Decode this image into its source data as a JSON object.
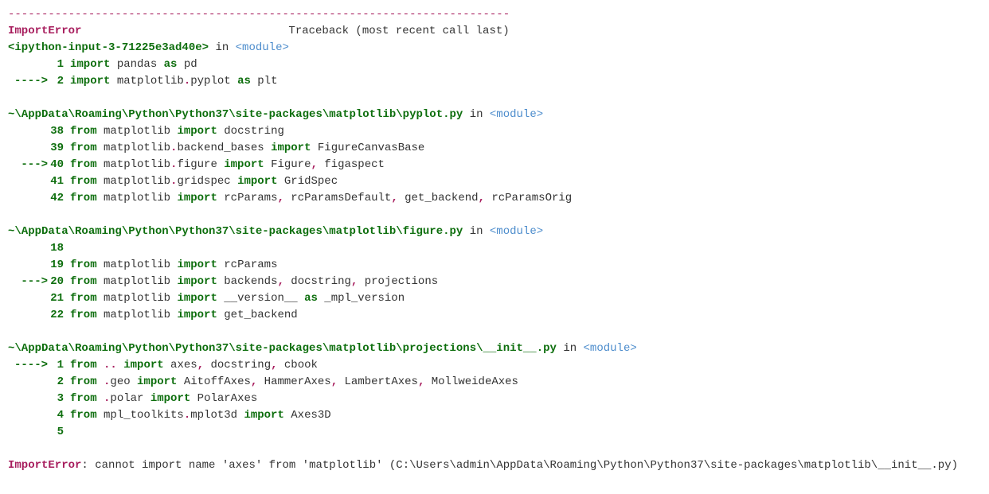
{
  "dashes": "---------------------------------------------------------------------------",
  "error_name": "ImportError",
  "traceback_label": "Traceback (most recent call last)",
  "frames": [
    {
      "path": "<ipython-input-3-71225e3ad40e>",
      "in": "in",
      "module": "<module>",
      "lines": [
        {
          "arrow": "",
          "no": "1",
          "tokens": [
            {
              "t": "import",
              "c": "kw"
            },
            {
              "t": " pandas ",
              "c": "name"
            },
            {
              "t": "as",
              "c": "kw"
            },
            {
              "t": " pd",
              "c": "name"
            }
          ]
        },
        {
          "arrow": "---->",
          "no": "2",
          "tokens": [
            {
              "t": "import",
              "c": "kw"
            },
            {
              "t": " matplotlib",
              "c": "name"
            },
            {
              "t": ".",
              "c": "op"
            },
            {
              "t": "pyplot ",
              "c": "name"
            },
            {
              "t": "as",
              "c": "kw"
            },
            {
              "t": " plt",
              "c": "name"
            }
          ]
        }
      ]
    },
    {
      "path": "~\\AppData\\Roaming\\Python\\Python37\\site-packages\\matplotlib\\pyplot.py",
      "in": "in",
      "module": "<module>",
      "lines": [
        {
          "arrow": "",
          "no": "38",
          "tokens": [
            {
              "t": "from",
              "c": "kw"
            },
            {
              "t": " matplotlib ",
              "c": "name"
            },
            {
              "t": "import",
              "c": "kw"
            },
            {
              "t": " docstring",
              "c": "name"
            }
          ]
        },
        {
          "arrow": "",
          "no": "39",
          "tokens": [
            {
              "t": "from",
              "c": "kw"
            },
            {
              "t": " matplotlib",
              "c": "name"
            },
            {
              "t": ".",
              "c": "op"
            },
            {
              "t": "backend_bases ",
              "c": "name"
            },
            {
              "t": "import",
              "c": "kw"
            },
            {
              "t": " FigureCanvasBase",
              "c": "name"
            }
          ]
        },
        {
          "arrow": "--->",
          "no": "40",
          "tokens": [
            {
              "t": "from",
              "c": "kw"
            },
            {
              "t": " matplotlib",
              "c": "name"
            },
            {
              "t": ".",
              "c": "op"
            },
            {
              "t": "figure ",
              "c": "name"
            },
            {
              "t": "import",
              "c": "kw"
            },
            {
              "t": " Figure",
              "c": "name"
            },
            {
              "t": ",",
              "c": "op"
            },
            {
              "t": " figaspect",
              "c": "name"
            }
          ]
        },
        {
          "arrow": "",
          "no": "41",
          "tokens": [
            {
              "t": "from",
              "c": "kw"
            },
            {
              "t": " matplotlib",
              "c": "name"
            },
            {
              "t": ".",
              "c": "op"
            },
            {
              "t": "gridspec ",
              "c": "name"
            },
            {
              "t": "import",
              "c": "kw"
            },
            {
              "t": " GridSpec",
              "c": "name"
            }
          ]
        },
        {
          "arrow": "",
          "no": "42",
          "tokens": [
            {
              "t": "from",
              "c": "kw"
            },
            {
              "t": " matplotlib ",
              "c": "name"
            },
            {
              "t": "import",
              "c": "kw"
            },
            {
              "t": " rcParams",
              "c": "name"
            },
            {
              "t": ",",
              "c": "op"
            },
            {
              "t": " rcParamsDefault",
              "c": "name"
            },
            {
              "t": ",",
              "c": "op"
            },
            {
              "t": " get_backend",
              "c": "name"
            },
            {
              "t": ",",
              "c": "op"
            },
            {
              "t": " rcParamsOrig",
              "c": "name"
            }
          ]
        }
      ]
    },
    {
      "path": "~\\AppData\\Roaming\\Python\\Python37\\site-packages\\matplotlib\\figure.py",
      "in": "in",
      "module": "<module>",
      "lines": [
        {
          "arrow": "",
          "no": "18",
          "tokens": []
        },
        {
          "arrow": "",
          "no": "19",
          "tokens": [
            {
              "t": "from",
              "c": "kw"
            },
            {
              "t": " matplotlib ",
              "c": "name"
            },
            {
              "t": "import",
              "c": "kw"
            },
            {
              "t": " rcParams",
              "c": "name"
            }
          ]
        },
        {
          "arrow": "--->",
          "no": "20",
          "tokens": [
            {
              "t": "from",
              "c": "kw"
            },
            {
              "t": " matplotlib ",
              "c": "name"
            },
            {
              "t": "import",
              "c": "kw"
            },
            {
              "t": " backends",
              "c": "name"
            },
            {
              "t": ",",
              "c": "op"
            },
            {
              "t": " docstring",
              "c": "name"
            },
            {
              "t": ",",
              "c": "op"
            },
            {
              "t": " projections",
              "c": "name"
            }
          ]
        },
        {
          "arrow": "",
          "no": "21",
          "tokens": [
            {
              "t": "from",
              "c": "kw"
            },
            {
              "t": " matplotlib ",
              "c": "name"
            },
            {
              "t": "import",
              "c": "kw"
            },
            {
              "t": " __version__ ",
              "c": "name"
            },
            {
              "t": "as",
              "c": "kw"
            },
            {
              "t": " _mpl_version",
              "c": "name"
            }
          ]
        },
        {
          "arrow": "",
          "no": "22",
          "tokens": [
            {
              "t": "from",
              "c": "kw"
            },
            {
              "t": " matplotlib ",
              "c": "name"
            },
            {
              "t": "import",
              "c": "kw"
            },
            {
              "t": " get_backend",
              "c": "name"
            }
          ]
        }
      ]
    },
    {
      "path": "~\\AppData\\Roaming\\Python\\Python37\\site-packages\\matplotlib\\projections\\__init__.py",
      "in": "in",
      "module": "<module>",
      "lines": [
        {
          "arrow": "---->",
          "no": "1",
          "tokens": [
            {
              "t": "from",
              "c": "kw"
            },
            {
              "t": " ",
              "c": "name"
            },
            {
              "t": "..",
              "c": "op"
            },
            {
              "t": " ",
              "c": "name"
            },
            {
              "t": "import",
              "c": "kw"
            },
            {
              "t": " axes",
              "c": "name"
            },
            {
              "t": ",",
              "c": "op"
            },
            {
              "t": " docstring",
              "c": "name"
            },
            {
              "t": ",",
              "c": "op"
            },
            {
              "t": " cbook",
              "c": "name"
            }
          ]
        },
        {
          "arrow": "",
          "no": "2",
          "tokens": [
            {
              "t": "from",
              "c": "kw"
            },
            {
              "t": " ",
              "c": "name"
            },
            {
              "t": ".",
              "c": "op"
            },
            {
              "t": "geo ",
              "c": "name"
            },
            {
              "t": "import",
              "c": "kw"
            },
            {
              "t": " AitoffAxes",
              "c": "name"
            },
            {
              "t": ",",
              "c": "op"
            },
            {
              "t": " HammerAxes",
              "c": "name"
            },
            {
              "t": ",",
              "c": "op"
            },
            {
              "t": " LambertAxes",
              "c": "name"
            },
            {
              "t": ",",
              "c": "op"
            },
            {
              "t": " MollweideAxes",
              "c": "name"
            }
          ]
        },
        {
          "arrow": "",
          "no": "3",
          "tokens": [
            {
              "t": "from",
              "c": "kw"
            },
            {
              "t": " ",
              "c": "name"
            },
            {
              "t": ".",
              "c": "op"
            },
            {
              "t": "polar ",
              "c": "name"
            },
            {
              "t": "import",
              "c": "kw"
            },
            {
              "t": " PolarAxes",
              "c": "name"
            }
          ]
        },
        {
          "arrow": "",
          "no": "4",
          "tokens": [
            {
              "t": "from",
              "c": "kw"
            },
            {
              "t": " mpl_toolkits",
              "c": "name"
            },
            {
              "t": ".",
              "c": "op"
            },
            {
              "t": "mplot3d ",
              "c": "name"
            },
            {
              "t": "import",
              "c": "kw"
            },
            {
              "t": " Axes3D",
              "c": "name"
            }
          ]
        },
        {
          "arrow": "",
          "no": "5",
          "tokens": []
        }
      ]
    }
  ],
  "final_error_name": "ImportError",
  "final_error_colon": ": ",
  "final_error_msg": "cannot import name 'axes' from 'matplotlib' (C:\\Users\\admin\\AppData\\Roaming\\Python\\Python37\\site-packages\\matplotlib\\__init__.py)"
}
